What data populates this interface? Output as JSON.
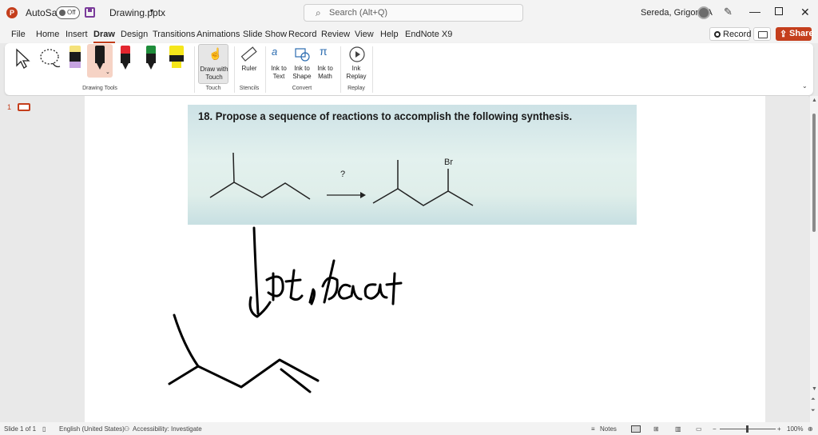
{
  "title_bar": {
    "autosave_label": "AutoSave",
    "autosave_state": "Off",
    "filename": "Drawing.pptx",
    "search_placeholder": "Search (Alt+Q)",
    "user_name": "Sereda, Grigoriy A"
  },
  "menu": {
    "tabs": [
      "File",
      "Home",
      "Insert",
      "Draw",
      "Design",
      "Transitions",
      "Animations",
      "Slide Show",
      "Record",
      "Review",
      "View",
      "Help",
      "EndNote X9"
    ],
    "active_tab": "Draw",
    "record_label": "Record",
    "share_label": "Share"
  },
  "ribbon": {
    "groups": {
      "drawing_tools": "Drawing Tools",
      "touch": "Touch",
      "stencils": "Stencils",
      "convert": "Convert",
      "replay": "Replay"
    },
    "draw_with_touch": [
      "Draw with",
      "Touch"
    ],
    "ruler": "Ruler",
    "ink_to_text": [
      "Ink to",
      "Text"
    ],
    "ink_to_shape": [
      "Ink to",
      "Shape"
    ],
    "ink_to_math": [
      "Ink to",
      "Math"
    ],
    "ink_replay": [
      "Ink",
      "Replay"
    ],
    "pen_colors": [
      "#e8e8e8",
      "#1b1b1b",
      "#e3262f",
      "#1e8c3a",
      "#f5e61b"
    ]
  },
  "slide_panel": {
    "slide_number": "1"
  },
  "slide": {
    "problem_text": "18. Propose a sequence of reactions to accomplish the following synthesis.",
    "question_mark": "?",
    "bromine_label": "Br"
  },
  "status_bar": {
    "slide_info": "Slide 1 of 1",
    "language": "English (United States)",
    "accessibility": "Accessibility: Investigate",
    "notes": "Notes",
    "zoom": "100%"
  },
  "colors": {
    "accent": "#c43e1c",
    "ribbon_bg": "#ffffff",
    "chrome_bg": "#f3f3f3"
  }
}
